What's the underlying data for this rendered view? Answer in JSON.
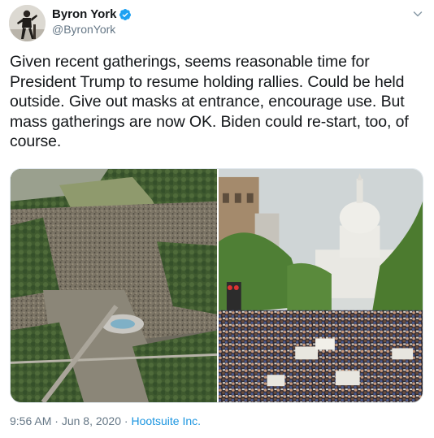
{
  "author": {
    "display_name": "Byron York",
    "handle": "@ByronYork",
    "verified": true
  },
  "tweet": {
    "text": "Given recent gatherings, seems reasonable time for President Trump to resume holding rallies. Could be held outside. Give out masks at entrance, encourage use. But mass gatherings are now OK. Biden could re-start, too, of course."
  },
  "meta": {
    "time": "9:56 AM",
    "separator_1": " · ",
    "date": "Jun 8, 2020",
    "separator_2": " · ",
    "source": "Hootsuite Inc."
  },
  "icons": {
    "verified": "verified-badge-icon",
    "more": "chevron-down-icon"
  },
  "colors": {
    "verified": "#1da1f2",
    "link": "#1b95e0",
    "secondary_text": "#657786"
  }
}
